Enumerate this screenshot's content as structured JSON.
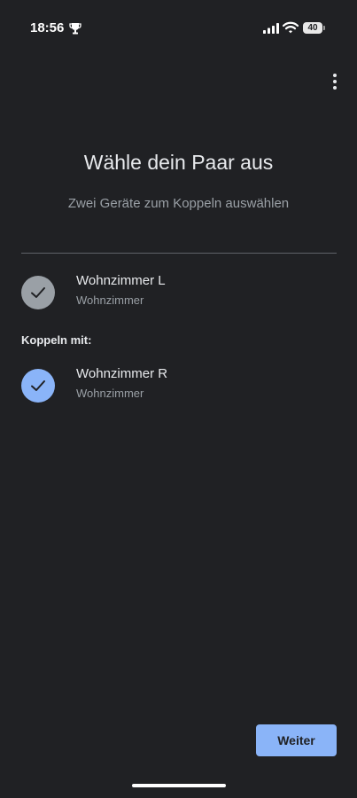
{
  "status_bar": {
    "time": "18:56",
    "battery_level": "40",
    "icons": [
      "trophy-icon",
      "signal-icon",
      "wifi-icon",
      "battery-icon"
    ]
  },
  "header": {
    "menu_icon": "overflow-menu-icon"
  },
  "main": {
    "title": "Wähle dein Paar aus",
    "subtitle": "Zwei Geräte zum Koppeln auswählen",
    "primary_device": {
      "name": "Wohnzimmer L",
      "room": "Wohnzimmer",
      "selected": true,
      "check_color": "#9aa0a6"
    },
    "pair_label": "Koppeln mit:",
    "pair_devices": [
      {
        "name": "Wohnzimmer R",
        "room": "Wohnzimmer",
        "selected": true,
        "check_color": "#8ab4f8"
      }
    ]
  },
  "footer": {
    "next_label": "Weiter"
  },
  "colors": {
    "background": "#202124",
    "accent": "#8ab4f8",
    "text_primary": "#e8eaed",
    "text_secondary": "#9aa0a6"
  }
}
